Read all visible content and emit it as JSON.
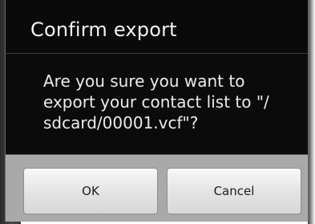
{
  "dialog": {
    "title": "Confirm export",
    "message": "Are you sure you want to export your contact list to \"/ sdcard/00001.vcf\"?",
    "ok_label": "OK",
    "cancel_label": "Cancel"
  },
  "colors": {
    "dialog_background": "#0b0b0b",
    "button_bar_background": "#a9a9a9",
    "button_face": "#e3e3e3",
    "title_text": "#f2f2f2"
  }
}
